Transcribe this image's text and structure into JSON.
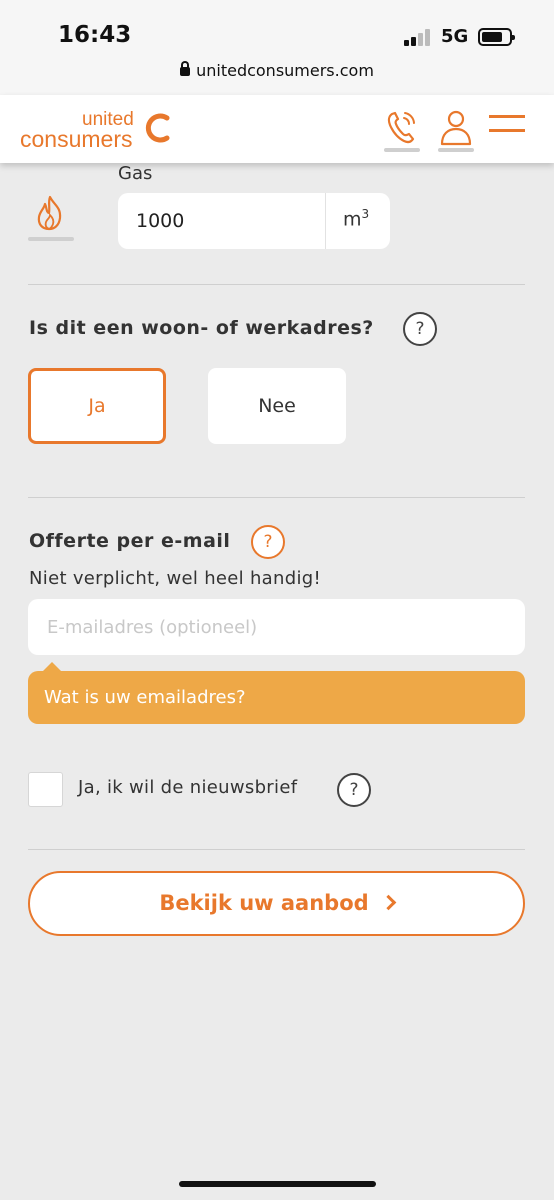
{
  "status_bar": {
    "time": "16:43",
    "network": "5G",
    "url": "unitedconsumers.com"
  },
  "header": {
    "logo_top": "united",
    "logo_bottom": "consumers",
    "icons": [
      "phone-icon",
      "account-icon",
      "menu-icon"
    ],
    "brand_color": "#e8782c"
  },
  "gas": {
    "label": "Gas",
    "value": "1000",
    "unit": "m",
    "unit_sup": "3",
    "icon": "flame-icon"
  },
  "address_question": {
    "title": "Is dit een woon- of werkadres?",
    "help": "?",
    "options": [
      {
        "label": "Ja",
        "selected": true
      },
      {
        "label": "Nee",
        "selected": false
      }
    ]
  },
  "email": {
    "title": "Offerte per e-mail",
    "help": "?",
    "subtitle": "Niet verplicht, wel heel handig!",
    "placeholder": "E-mailadres (optioneel)",
    "value": "",
    "tooltip": "Wat is uw emailadres?",
    "tooltip_color": "#eea847"
  },
  "newsletter": {
    "label": "Ja, ik wil de nieuwsbrief",
    "help": "?",
    "checked": false
  },
  "cta": {
    "label": "Bekijk uw aanbod"
  }
}
